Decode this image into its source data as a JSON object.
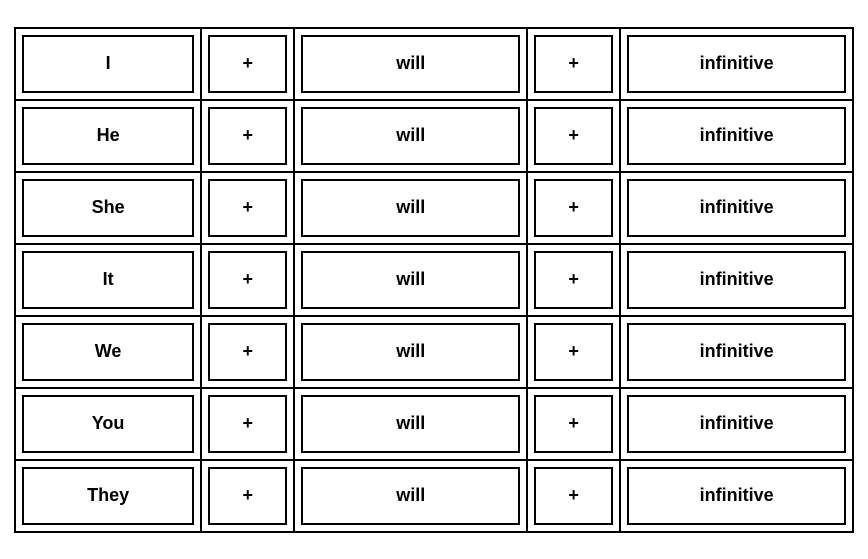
{
  "table": {
    "rows": [
      {
        "subject": "I",
        "plus1": "+",
        "will": "will",
        "plus2": "+",
        "infinitive": "infinitive"
      },
      {
        "subject": "He",
        "plus1": "+",
        "will": "will",
        "plus2": "+",
        "infinitive": "infinitive"
      },
      {
        "subject": "She",
        "plus1": "+",
        "will": "will",
        "plus2": "+",
        "infinitive": "infinitive"
      },
      {
        "subject": "It",
        "plus1": "+",
        "will": "will",
        "plus2": "+",
        "infinitive": "infinitive"
      },
      {
        "subject": "We",
        "plus1": "+",
        "will": "will",
        "plus2": "+",
        "infinitive": "infinitive"
      },
      {
        "subject": "You",
        "plus1": "+",
        "will": "will",
        "plus2": "+",
        "infinitive": "infinitive"
      },
      {
        "subject": "They",
        "plus1": "+",
        "will": "will",
        "plus2": "+",
        "infinitive": "infinitive"
      }
    ]
  }
}
